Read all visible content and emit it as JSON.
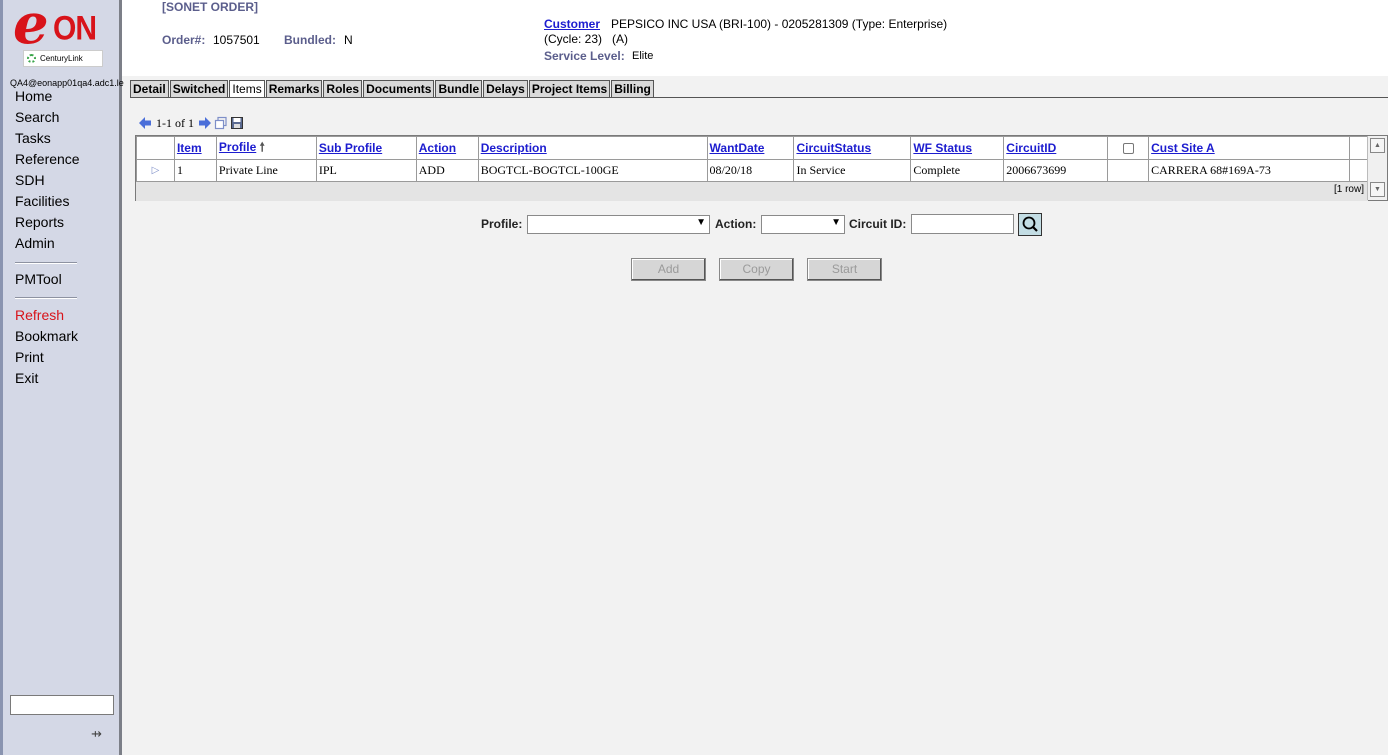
{
  "sidebar": {
    "logo_text": "eON",
    "logo_sub": "CenturyLink",
    "user": "QA4@eonapp01qa4.adc1.le",
    "nav_primary": [
      "Home",
      "Search",
      "Tasks",
      "Reference",
      "SDH",
      "Facilities",
      "Reports",
      "Admin"
    ],
    "nav_tool": "PMTool",
    "nav_actions": [
      "Refresh",
      "Bookmark",
      "Print",
      "Exit"
    ],
    "pin_icon": "pin-icon"
  },
  "header": {
    "order_type": "[SONET ORDER]",
    "order_label": "Order#:",
    "order_value": "1057501",
    "bundled_label": "Bundled:",
    "bundled_value": "N",
    "customer_label": "Customer",
    "customer_value": "PEPSICO INC USA (BRI-100) - 0205281309 (Type: Enterprise)",
    "cycle_value": "(Cycle: 23)   (A)",
    "service_label": "Service Level:",
    "service_value": "Elite"
  },
  "tabs": [
    "Detail",
    "Switched",
    "Items",
    "Remarks",
    "Roles",
    "Documents",
    "Bundle",
    "Delays",
    "Project Items",
    "Billing"
  ],
  "active_tab": "Items",
  "pager": {
    "text": "1-1 of 1"
  },
  "table": {
    "headers": {
      "item": "Item",
      "profile": "Profile",
      "sub_profile": "Sub Profile",
      "action": "Action",
      "description": "Description",
      "want_date": "WantDate",
      "circuit_status": "CircuitStatus",
      "wf_status": "WF Status",
      "circuit_id": "CircuitID",
      "cust_site_a": "Cust Site A"
    },
    "rows": [
      {
        "item": "1",
        "profile": "Private Line",
        "sub_profile": "IPL",
        "action": "ADD",
        "description": "BOGTCL-BOGTCL-100GE",
        "want_date": "08/20/18",
        "circuit_status": "In Service",
        "wf_status": "Complete",
        "circuit_id": "2006673699",
        "cust_site_a": "CARRERA 68#169A-73",
        "row_no": "1"
      }
    ],
    "row_count": "[1 row]"
  },
  "filter": {
    "profile_label": "Profile:",
    "profile_value": "",
    "action_label": "Action:",
    "action_value": "",
    "circuit_label": "Circuit ID:",
    "circuit_value": ""
  },
  "buttons": {
    "add": "Add",
    "copy": "Copy",
    "start": "Start"
  },
  "colors": {
    "brand_red": "#d8131a",
    "link_blue": "#1c1ccf",
    "label_purple": "#5b5e8c",
    "sidebar_bg": "#d4d8e6"
  }
}
